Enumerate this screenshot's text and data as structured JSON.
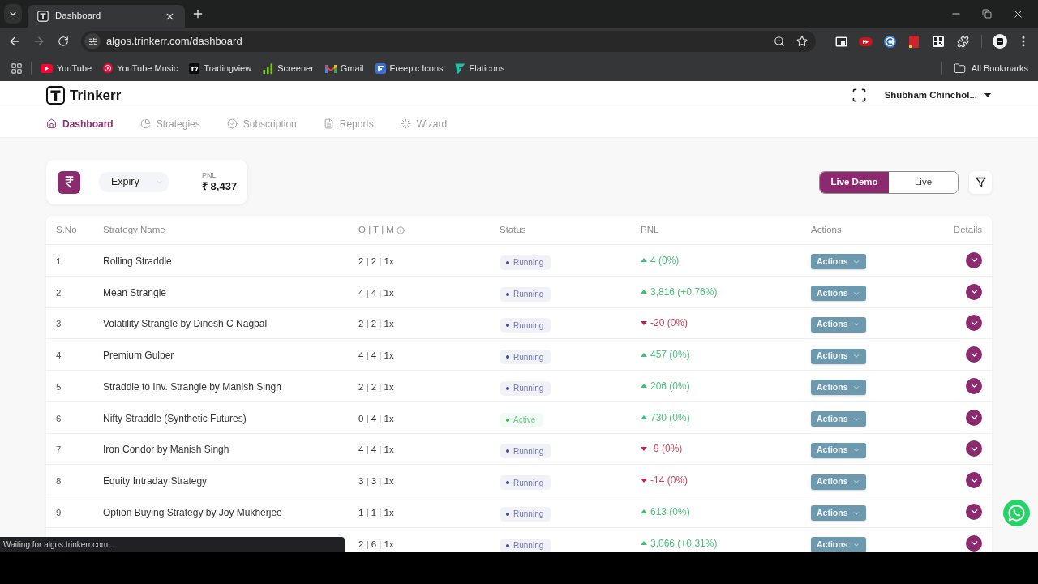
{
  "browser": {
    "tabs": [
      {
        "title": "Dashboard",
        "selected": true
      }
    ],
    "address": "algos.trinkerr.com/dashboard",
    "bookmarks": [
      {
        "label": "YouTube",
        "kind": "play"
      },
      {
        "label": "YouTube Music",
        "kind": "play-circle"
      },
      {
        "label": "Tradingview",
        "kind": "tv"
      },
      {
        "label": "Screener",
        "kind": "bars"
      },
      {
        "label": "Gmail",
        "kind": "mail"
      },
      {
        "label": "Freepic Icons",
        "kind": "f-tile"
      },
      {
        "label": "Flaticons",
        "kind": "leaf"
      }
    ],
    "all_bookmarks": "All Bookmarks",
    "status": "Waiting for algos.trinkerr.com..."
  },
  "header": {
    "brand": "Trinkerr",
    "user": "Shubham Chinchol..."
  },
  "nav": [
    {
      "label": "Dashboard",
      "kind": "home",
      "selected": true
    },
    {
      "label": "Strategies",
      "kind": "pie",
      "selected": false
    },
    {
      "label": "Subscription",
      "kind": "check",
      "selected": false
    },
    {
      "label": "Reports",
      "kind": "document",
      "selected": false
    },
    {
      "label": "Wizard",
      "kind": "spinner",
      "selected": false
    }
  ],
  "summary": {
    "period": "Expiry",
    "pnl_label": "PNL",
    "pnl_value": "₹ 8,437"
  },
  "mode_toggle": [
    {
      "label": "Live Demo",
      "selected": true
    },
    {
      "label": "Live",
      "selected": false
    }
  ],
  "table": {
    "columns": [
      {
        "label": "S.No"
      },
      {
        "label": "Strategy Name"
      },
      {
        "label": "O | T | M",
        "info": true
      },
      {
        "label": "Status"
      },
      {
        "label": "PNL"
      },
      {
        "label": "Actions"
      },
      {
        "label": "Details"
      }
    ],
    "rows": [
      {
        "sno": "1",
        "name": "Rolling Straddle",
        "otm": "2 | 2 | 1x",
        "status": {
          "label": "Running",
          "color": "#3f4596"
        },
        "pnl": "4 (0%)",
        "gain": true,
        "action": "Actions"
      },
      {
        "sno": "2",
        "name": "Mean Strangle",
        "otm": "4 | 4 | 1x",
        "status": {
          "label": "Running",
          "color": "#3f4596"
        },
        "pnl": "3,816 (+0.76%)",
        "gain": true,
        "action": "Actions"
      },
      {
        "sno": "3",
        "name": "Volatility Strangle by Dinesh C Nagpal",
        "otm": "2 | 2 | 1x",
        "status": {
          "label": "Running",
          "color": "#3f4596"
        },
        "pnl": "-20 (0%)",
        "gain": false,
        "action": "Actions"
      },
      {
        "sno": "4",
        "name": "Premium Gulper",
        "otm": "4 | 4 | 1x",
        "status": {
          "label": "Running",
          "color": "#3f4596"
        },
        "pnl": "457 (0%)",
        "gain": true,
        "action": "Actions"
      },
      {
        "sno": "5",
        "name": "Straddle to Inv. Strangle by Manish Singh",
        "otm": "2 | 2 | 1x",
        "status": {
          "label": "Running",
          "color": "#3f4596"
        },
        "pnl": "206 (0%)",
        "gain": true,
        "action": "Actions"
      },
      {
        "sno": "6",
        "name": "Nifty Straddle (Synthetic Futures)",
        "otm": "0 | 4 | 1x",
        "status": {
          "label": "Active",
          "color": "#35b765"
        },
        "pnl": "730 (0%)",
        "gain": true,
        "action": "Actions"
      },
      {
        "sno": "7",
        "name": "Iron Condor by Manish Singh",
        "otm": "4 | 4 | 1x",
        "status": {
          "label": "Running",
          "color": "#3f4596"
        },
        "pnl": "-9 (0%)",
        "gain": false,
        "action": "Actions"
      },
      {
        "sno": "8",
        "name": "Equity Intraday Strategy",
        "otm": "3 | 3 | 1x",
        "status": {
          "label": "Running",
          "color": "#3f4596"
        },
        "pnl": "-14 (0%)",
        "gain": false,
        "action": "Actions"
      },
      {
        "sno": "9",
        "name": "Option Buying Strategy by Joy Mukherjee",
        "otm": "1 | 1 | 1x",
        "status": {
          "label": "Running",
          "color": "#3f4596"
        },
        "pnl": "613 (0%)",
        "gain": true,
        "action": "Actions"
      },
      {
        "otm": "2 | 6 | 1x",
        "status": {
          "label": "Running",
          "color": "#3f4596"
        },
        "pnl": "3,066 (+0.31%)",
        "gain": true,
        "action": "Actions"
      }
    ]
  }
}
